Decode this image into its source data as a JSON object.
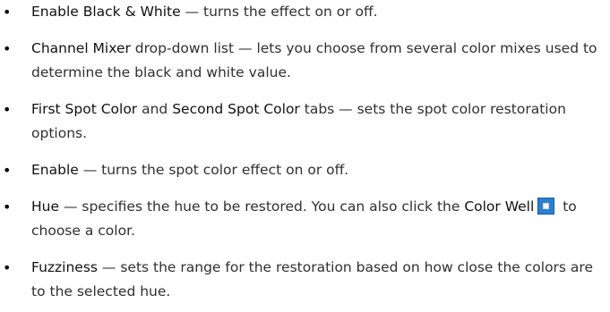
{
  "bullet_char": "•",
  "items": [
    {
      "term": "Enable Black & White",
      "text": " — turns the effect on or off."
    },
    {
      "term": "Channel Mixer",
      "text": " drop-down list — lets you choose from several color mixes used to determine the black and white value."
    },
    {
      "term_a": "First Spot Color",
      "between": " and ",
      "term_b": "Second Spot Color",
      "text": " tabs — sets the spot color restoration options."
    },
    {
      "term": "Enable",
      "text": " — turns the spot color effect on or off."
    },
    {
      "term": "Hue",
      "text": " — specifies the hue to be restored. You can also click the ",
      "term_2": "Color Well",
      "text_2": " to choose a color.",
      "icon": "color-well-icon"
    },
    {
      "term": "Fuzziness",
      "text": " — sets the range for the restoration based on how close the colors are to the selected hue."
    }
  ]
}
